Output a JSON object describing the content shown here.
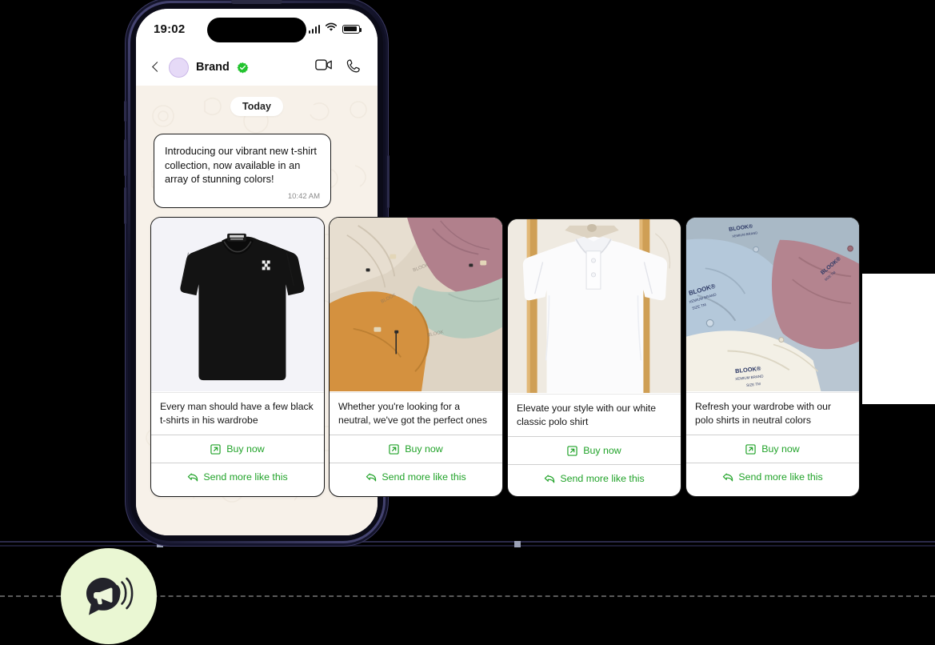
{
  "phone": {
    "status_bar": {
      "time": "19:02",
      "signal_icon": "cellular-bars-icon",
      "wifi_icon": "wifi-icon",
      "battery_icon": "battery-icon"
    },
    "chat_header": {
      "back_icon": "chevron-left-icon",
      "avatar_icon": "avatar",
      "brand_name": "Brand",
      "verified_icon": "verified-badge-icon",
      "video_call_icon": "video-camera-icon",
      "voice_call_icon": "phone-handset-icon"
    },
    "chat": {
      "date_divider": "Today",
      "message": {
        "text": "Introducing our vibrant new t-shirt collection, now available in an array of stunning colors!",
        "time": "10:42 AM"
      }
    }
  },
  "cards": [
    {
      "image_alt": "black-tshirt",
      "caption": "Every man should have a few black t-shirts in his wardrobe",
      "buy_label": "Buy now",
      "buy_icon": "external-link-icon",
      "more_label": "Send more like this",
      "more_icon": "reply-arrow-icon"
    },
    {
      "image_alt": "folded-tshirts-neutral-colors",
      "caption": "Whether you're looking for a neutral, we've got the perfect ones",
      "buy_label": "Buy now",
      "buy_icon": "external-link-icon",
      "more_label": "Send more like this",
      "more_icon": "reply-arrow-icon"
    },
    {
      "image_alt": "white-polo-shirt-on-hanger",
      "caption": "Elevate your style with our white classic polo shirt",
      "buy_label": "Buy now",
      "buy_icon": "external-link-icon",
      "more_label": "Send more like this",
      "more_icon": "reply-arrow-icon"
    },
    {
      "image_alt": "stacked-polo-shirt-collars",
      "caption": "Refresh your wardrobe with our polo shirts in neutral colors",
      "buy_label": "Buy now",
      "buy_icon": "external-link-icon",
      "more_label": "Send more like this",
      "more_icon": "reply-arrow-icon"
    }
  ],
  "badge": {
    "icon": "megaphone-speech-bubble-icon"
  },
  "colors": {
    "accent_green": "#22a32a",
    "verified_green": "#22c32e",
    "badge_bg": "#eaf7d3",
    "chat_bg": "#f7f1e9",
    "frame_navy": "#14142b",
    "guide_navy": "#2b2a4a"
  }
}
